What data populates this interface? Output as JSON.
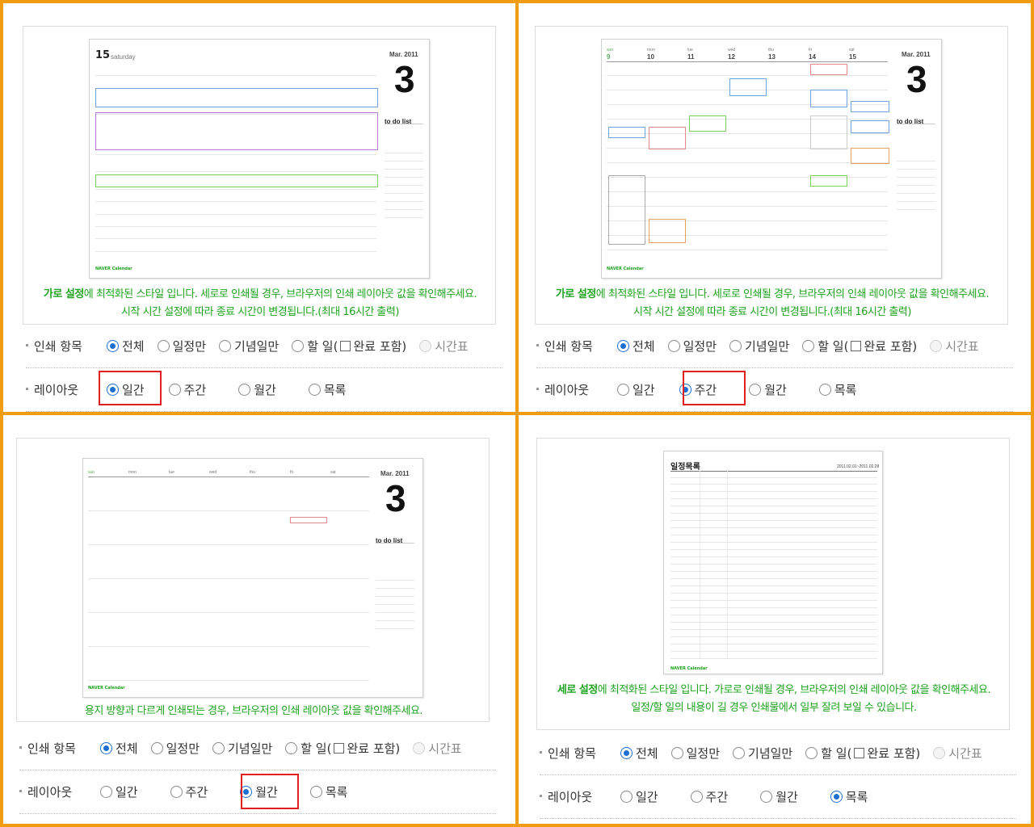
{
  "print_items": {
    "label": "인쇄 항목",
    "options": [
      "전체",
      "일정만",
      "기념일만",
      "할 일(",
      "완료 포함)",
      "시간표"
    ]
  },
  "layout": {
    "label": "레이아웃",
    "options": [
      "일간",
      "주간",
      "월간",
      "목록"
    ]
  },
  "panels": [
    {
      "layout_selected": "일간",
      "caption_bold": "가로 설정",
      "caption_line1": "에 최적화된 스타일 입니다. 세로로 인쇄될 경우, 브라우저의 인쇄 레이아웃 값을 확인해주세요.",
      "caption_line2": "시작 시간 설정에 따라 종료 시간이 변경됩니다.(최대 16시간 출력)",
      "preview": {
        "day": "15",
        "weekday": "saturday",
        "month": "Mar. 2011",
        "big": "3",
        "todo": "to do list"
      }
    },
    {
      "layout_selected": "주간",
      "caption_bold": "가로 설정",
      "caption_line1": "에 최적화된 스타일 입니다. 세로로 인쇄될 경우, 브라우저의 인쇄 레이아웃 값을 확인해주세요.",
      "caption_line2": "시작 시간 설정에 따라 종료 시간이 변경됩니다.(최대 16시간 출력)",
      "preview": {
        "days": [
          "sun",
          "mon",
          "tue",
          "wed",
          "thu",
          "fri",
          "sat"
        ],
        "dates": [
          "9",
          "10",
          "11",
          "12",
          "13",
          "14",
          "15"
        ],
        "month": "Mar. 2011",
        "big": "3",
        "todo": "to do list"
      }
    },
    {
      "layout_selected": "월간",
      "caption_line1": "용지 방향과 다르게 인쇄되는 경우, 브라우저의 인쇄 레이아웃 값을 확인해주세요.",
      "preview": {
        "days": [
          "sun",
          "mon",
          "tue",
          "wed",
          "thu",
          "fri",
          "sat"
        ],
        "month": "Mar. 2011",
        "big": "3",
        "todo": "to do list"
      }
    },
    {
      "layout_selected": "목록",
      "caption_bold": "세로 설정",
      "caption_line1": "에 최적화된 스타일 입니다. 가로로 인쇄될 경우, 브라우저의 인쇄 레이아웃 값을 확인해주세요.",
      "caption_line2": "일정/할 일의 내용이 길 경우 인쇄물에서 일부 잘려 보일 수 있습니다.",
      "preview": {
        "title": "일정목록",
        "range": "2011.02.01~2011.02.28"
      }
    }
  ],
  "colors": {
    "frame": "#f39c12",
    "caption": "#1fa31f",
    "radio_on": "#1c6fd1",
    "highlight": "#e02020"
  }
}
